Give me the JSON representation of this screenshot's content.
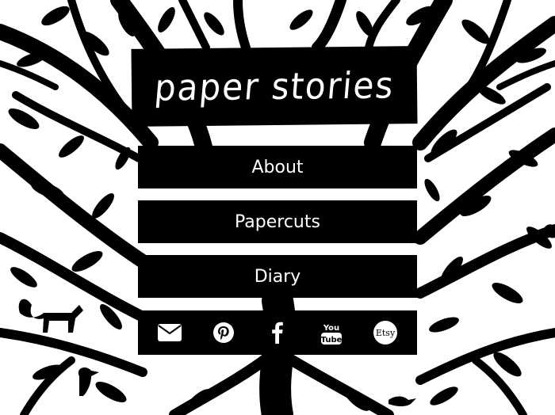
{
  "site": {
    "logo_text": "paper stories"
  },
  "nav": {
    "items": [
      {
        "label": "About"
      },
      {
        "label": "Papercuts"
      },
      {
        "label": "Diary"
      }
    ]
  },
  "social": {
    "icons": [
      "mail-icon",
      "pinterest-icon",
      "facebook-icon",
      "youtube-icon",
      "etsy-icon"
    ],
    "youtube_text": "You Tube",
    "etsy_text": "Etsy"
  },
  "colors": {
    "panel": "#000000",
    "text": "#ffffff",
    "background": "#ffffff"
  }
}
